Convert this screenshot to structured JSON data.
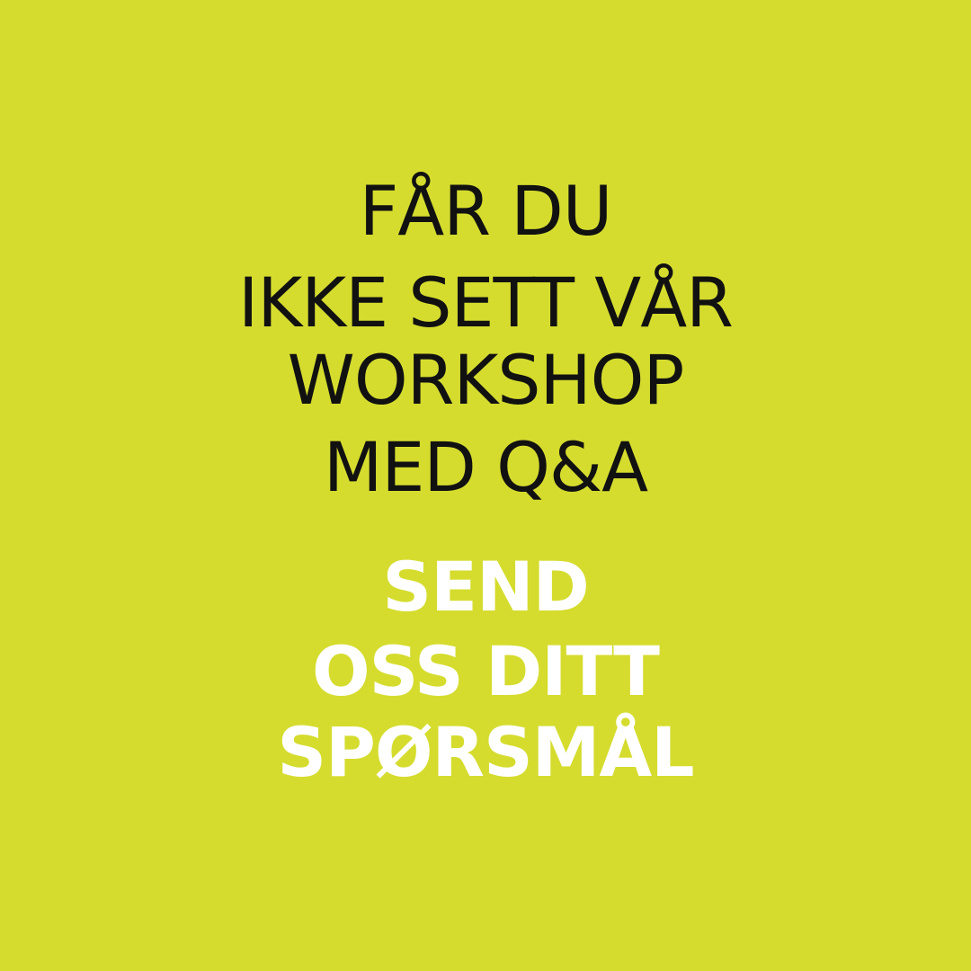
{
  "colors": {
    "background": "#d5dc2e",
    "headline_text": "#111111",
    "cta_text": "#ffffff"
  },
  "headline": {
    "lines": [
      "FÅR DU",
      "IKKE SETT VÅR",
      "WORKSHOP",
      "MED Q&A"
    ]
  },
  "call_to_action": {
    "lines": [
      "SEND",
      "OSS DITT",
      "SPØRSMÅL"
    ]
  }
}
